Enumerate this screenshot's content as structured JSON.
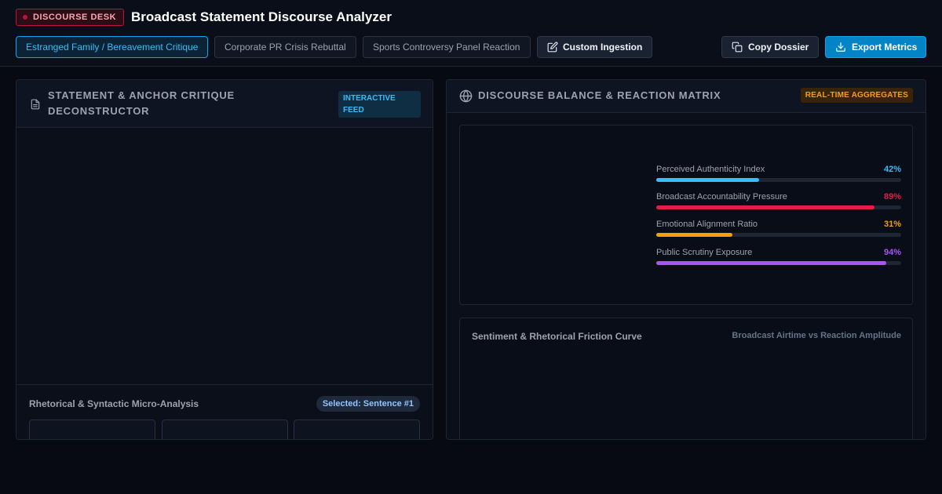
{
  "header": {
    "brand_badge": "DISCOURSE DESK",
    "app_title": "Broadcast Statement Discourse Analyzer",
    "tabs": [
      {
        "label": "Estranged Family / Bereavement Critique",
        "active": true
      },
      {
        "label": "Corporate PR Crisis Rebuttal",
        "active": false
      },
      {
        "label": "Sports Controversy Panel Reaction",
        "active": false
      }
    ],
    "custom_ingestion_label": "Custom Ingestion",
    "copy_label": "Copy Dossier",
    "export_label": "Export Metrics"
  },
  "left_panel": {
    "title": "STATEMENT & ANCHOR CRITIQUE DECONSTRUCTOR",
    "badge": "INTERACTIVE FEED",
    "micro": {
      "title": "Rhetorical & Syntactic Micro-Analysis",
      "selected": "Selected: Sentence #1"
    }
  },
  "right_panel": {
    "title": "DISCOURSE BALANCE & REACTION MATRIX",
    "badge": "REAL-TIME AGGREGATES",
    "metrics": [
      {
        "label": "Perceived Authenticity Index",
        "value": "42%",
        "fraction": 0.42,
        "color": "#38bdf8"
      },
      {
        "label": "Broadcast Accountability Pressure",
        "value": "89%",
        "fraction": 0.89,
        "color": "#e11d48"
      },
      {
        "label": "Emotional Alignment Ratio",
        "value": "31%",
        "fraction": 0.31,
        "color": "#f59e0b"
      },
      {
        "label": "Public Scrutiny Exposure",
        "value": "94%",
        "fraction": 0.94,
        "color": "#a855f7"
      }
    ],
    "curve": {
      "title": "Sentiment & Rhetorical Friction Curve",
      "subtitle": "Broadcast Airtime vs Reaction Amplitude"
    }
  },
  "colors": {
    "accent": "#0ea5e9",
    "brand": "#be123c",
    "background": "#070a12"
  }
}
